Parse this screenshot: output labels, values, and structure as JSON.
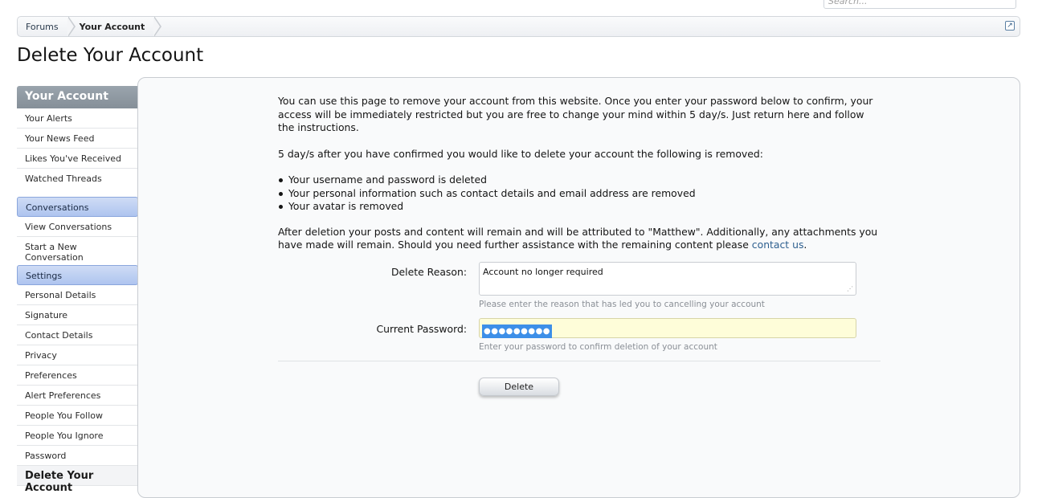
{
  "search": {
    "placeholder": "Search..."
  },
  "breadcrumb": {
    "items": [
      "Forums",
      "Your Account"
    ]
  },
  "page_title": "Delete Your Account",
  "sidebar": {
    "header": "Your Account",
    "account_items": [
      "Your Alerts",
      "Your News Feed",
      "Likes You've Received",
      "Watched Threads"
    ],
    "conversations_label": "Conversations",
    "conversation_items": [
      "View Conversations",
      "Start a New Conversation"
    ],
    "settings_label": "Settings",
    "settings_items": [
      "Personal Details",
      "Signature",
      "Contact Details",
      "Privacy",
      "Preferences",
      "Alert Preferences",
      "People You Follow",
      "People You Ignore",
      "Password"
    ],
    "active_item": "Delete Your Account"
  },
  "content": {
    "intro": "You can use this page to remove your account from this website. Once you enter your password below to confirm, your access will be immediately restricted but you are free to change your mind within 5 day/s. Just return here and follow the instructions.",
    "removed_heading": "5 day/s after you have confirmed you would like to delete your account the following is removed:",
    "removed_items": [
      "Your username and password is deleted",
      "Your personal information such as contact details and email address are removed",
      "Your avatar is removed"
    ],
    "after_text": "After deletion your posts and content will remain and will be attributed to \"Matthew\". Additionally, any attachments you have made will remain. Should you need further assistance with the remaining content please ",
    "contact_link": "contact us",
    "after_end": "."
  },
  "form": {
    "reason_label": "Delete Reason:",
    "reason_value": "Account no longer required",
    "reason_hint": "Please enter the reason that has led you to cancelling your account",
    "password_label": "Current Password:",
    "password_value": "●●●●●●●●●",
    "password_hint": "Enter your password to confirm deletion of your account",
    "submit_label": "Delete"
  },
  "colors": {
    "sidebar_header": "#8a949d",
    "section_bg": "#bcd0f2",
    "password_bg": "#fefdd9",
    "selection": "#3d8fe8",
    "link": "#2d5f8f"
  }
}
